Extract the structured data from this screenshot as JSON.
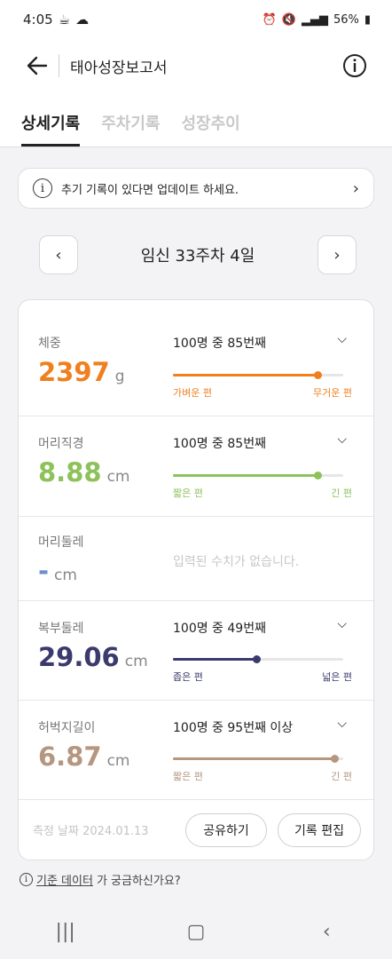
{
  "status": {
    "time": "4:05",
    "battery": "56%"
  },
  "app": {
    "title": "태아성장보고서"
  },
  "tabs": [
    "상세기록",
    "주차기록",
    "성장추이"
  ],
  "notice": {
    "text": "추기 기록이 있다면 업데이트 하세요."
  },
  "week": {
    "label": "임신 33주차 4일"
  },
  "metrics": [
    {
      "name": "체중",
      "value": "2397",
      "unit": "g",
      "rank": "100명 중 85번째",
      "lo": "가벼운 편",
      "hi": "무거운 편",
      "percent": 85,
      "color": "#f07f1e"
    },
    {
      "name": "머리직경",
      "value": "8.88",
      "unit": "cm",
      "rank": "100명 중 85번째",
      "lo": "짧은 편",
      "hi": "긴 편",
      "percent": 85,
      "color": "#8dc25a"
    },
    {
      "name": "머리둘레",
      "value": "-",
      "unit": "cm",
      "empty": "입력된 수치가 없습니다.",
      "color": "#6b8fc8"
    },
    {
      "name": "복부둘레",
      "value": "29.06",
      "unit": "cm",
      "rank": "100명 중 49번째",
      "lo": "좁은 편",
      "hi": "넓은 편",
      "percent": 49,
      "color": "#3b3a6e"
    },
    {
      "name": "허벅지길이",
      "value": "6.87",
      "unit": "cm",
      "rank": "100명 중 95번째 이상",
      "lo": "짧은 편",
      "hi": "긴 편",
      "percent": 95,
      "color": "#b5967f"
    }
  ],
  "footer": {
    "date": "측정 날짜 2024.01.13",
    "share": "공유하기",
    "edit": "기록 편집"
  },
  "helper": {
    "link": "기준 데이터",
    "rest": "가 궁금하신가요?"
  }
}
